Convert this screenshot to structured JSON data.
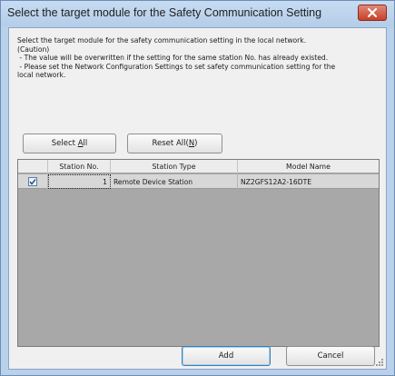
{
  "window": {
    "title": "Select the target module for the Safety Communication Setting"
  },
  "description": {
    "lines": [
      "Select the target module for the safety communication setting in the local network.",
      "(Caution)",
      " - The value will be overwritten if the setting for the same station No. has already existed.",
      " - Please set the Network Configuration Settings to set safety communication setting for the",
      "local network."
    ]
  },
  "buttons": {
    "select_all": "Select All",
    "select_all_mnemonic": "A",
    "reset_all": "Reset All(N)",
    "reset_all_mnemonic": "N",
    "add": "Add",
    "cancel": "Cancel"
  },
  "table": {
    "columns": [
      "",
      "Station No.",
      "Station Type",
      "Model Name"
    ],
    "rows": [
      {
        "checked": true,
        "station_no": "1",
        "station_type": "Remote Device Station",
        "model_name": "NZ2GFS12A2-16DTE"
      }
    ]
  },
  "colors": {
    "frame": "#b9d1ea",
    "close_button": "#c7402a",
    "grid_background": "#a8a8a8",
    "selected_row": "#d7d7d7"
  }
}
